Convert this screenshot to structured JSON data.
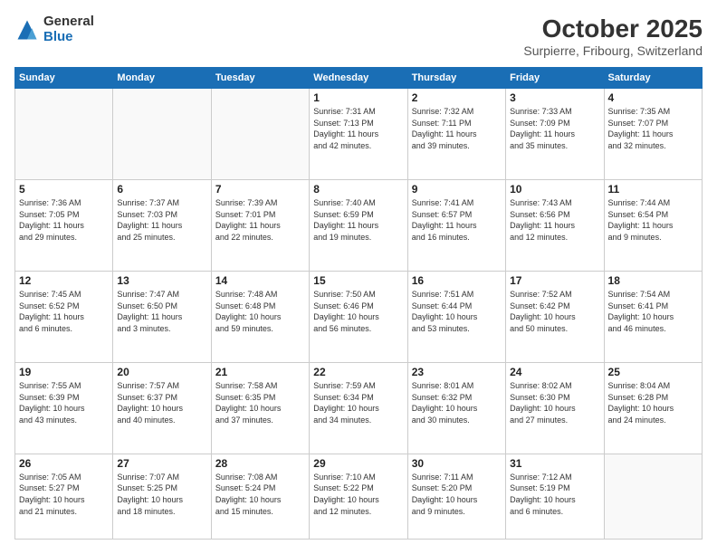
{
  "logo": {
    "general": "General",
    "blue": "Blue"
  },
  "header": {
    "month": "October 2025",
    "location": "Surpierre, Fribourg, Switzerland"
  },
  "weekdays": [
    "Sunday",
    "Monday",
    "Tuesday",
    "Wednesday",
    "Thursday",
    "Friday",
    "Saturday"
  ],
  "weeks": [
    [
      {
        "day": "",
        "info": ""
      },
      {
        "day": "",
        "info": ""
      },
      {
        "day": "",
        "info": ""
      },
      {
        "day": "1",
        "info": "Sunrise: 7:31 AM\nSunset: 7:13 PM\nDaylight: 11 hours\nand 42 minutes."
      },
      {
        "day": "2",
        "info": "Sunrise: 7:32 AM\nSunset: 7:11 PM\nDaylight: 11 hours\nand 39 minutes."
      },
      {
        "day": "3",
        "info": "Sunrise: 7:33 AM\nSunset: 7:09 PM\nDaylight: 11 hours\nand 35 minutes."
      },
      {
        "day": "4",
        "info": "Sunrise: 7:35 AM\nSunset: 7:07 PM\nDaylight: 11 hours\nand 32 minutes."
      }
    ],
    [
      {
        "day": "5",
        "info": "Sunrise: 7:36 AM\nSunset: 7:05 PM\nDaylight: 11 hours\nand 29 minutes."
      },
      {
        "day": "6",
        "info": "Sunrise: 7:37 AM\nSunset: 7:03 PM\nDaylight: 11 hours\nand 25 minutes."
      },
      {
        "day": "7",
        "info": "Sunrise: 7:39 AM\nSunset: 7:01 PM\nDaylight: 11 hours\nand 22 minutes."
      },
      {
        "day": "8",
        "info": "Sunrise: 7:40 AM\nSunset: 6:59 PM\nDaylight: 11 hours\nand 19 minutes."
      },
      {
        "day": "9",
        "info": "Sunrise: 7:41 AM\nSunset: 6:57 PM\nDaylight: 11 hours\nand 16 minutes."
      },
      {
        "day": "10",
        "info": "Sunrise: 7:43 AM\nSunset: 6:56 PM\nDaylight: 11 hours\nand 12 minutes."
      },
      {
        "day": "11",
        "info": "Sunrise: 7:44 AM\nSunset: 6:54 PM\nDaylight: 11 hours\nand 9 minutes."
      }
    ],
    [
      {
        "day": "12",
        "info": "Sunrise: 7:45 AM\nSunset: 6:52 PM\nDaylight: 11 hours\nand 6 minutes."
      },
      {
        "day": "13",
        "info": "Sunrise: 7:47 AM\nSunset: 6:50 PM\nDaylight: 11 hours\nand 3 minutes."
      },
      {
        "day": "14",
        "info": "Sunrise: 7:48 AM\nSunset: 6:48 PM\nDaylight: 10 hours\nand 59 minutes."
      },
      {
        "day": "15",
        "info": "Sunrise: 7:50 AM\nSunset: 6:46 PM\nDaylight: 10 hours\nand 56 minutes."
      },
      {
        "day": "16",
        "info": "Sunrise: 7:51 AM\nSunset: 6:44 PM\nDaylight: 10 hours\nand 53 minutes."
      },
      {
        "day": "17",
        "info": "Sunrise: 7:52 AM\nSunset: 6:42 PM\nDaylight: 10 hours\nand 50 minutes."
      },
      {
        "day": "18",
        "info": "Sunrise: 7:54 AM\nSunset: 6:41 PM\nDaylight: 10 hours\nand 46 minutes."
      }
    ],
    [
      {
        "day": "19",
        "info": "Sunrise: 7:55 AM\nSunset: 6:39 PM\nDaylight: 10 hours\nand 43 minutes."
      },
      {
        "day": "20",
        "info": "Sunrise: 7:57 AM\nSunset: 6:37 PM\nDaylight: 10 hours\nand 40 minutes."
      },
      {
        "day": "21",
        "info": "Sunrise: 7:58 AM\nSunset: 6:35 PM\nDaylight: 10 hours\nand 37 minutes."
      },
      {
        "day": "22",
        "info": "Sunrise: 7:59 AM\nSunset: 6:34 PM\nDaylight: 10 hours\nand 34 minutes."
      },
      {
        "day": "23",
        "info": "Sunrise: 8:01 AM\nSunset: 6:32 PM\nDaylight: 10 hours\nand 30 minutes."
      },
      {
        "day": "24",
        "info": "Sunrise: 8:02 AM\nSunset: 6:30 PM\nDaylight: 10 hours\nand 27 minutes."
      },
      {
        "day": "25",
        "info": "Sunrise: 8:04 AM\nSunset: 6:28 PM\nDaylight: 10 hours\nand 24 minutes."
      }
    ],
    [
      {
        "day": "26",
        "info": "Sunrise: 7:05 AM\nSunset: 5:27 PM\nDaylight: 10 hours\nand 21 minutes."
      },
      {
        "day": "27",
        "info": "Sunrise: 7:07 AM\nSunset: 5:25 PM\nDaylight: 10 hours\nand 18 minutes."
      },
      {
        "day": "28",
        "info": "Sunrise: 7:08 AM\nSunset: 5:24 PM\nDaylight: 10 hours\nand 15 minutes."
      },
      {
        "day": "29",
        "info": "Sunrise: 7:10 AM\nSunset: 5:22 PM\nDaylight: 10 hours\nand 12 minutes."
      },
      {
        "day": "30",
        "info": "Sunrise: 7:11 AM\nSunset: 5:20 PM\nDaylight: 10 hours\nand 9 minutes."
      },
      {
        "day": "31",
        "info": "Sunrise: 7:12 AM\nSunset: 5:19 PM\nDaylight: 10 hours\nand 6 minutes."
      },
      {
        "day": "",
        "info": ""
      }
    ]
  ]
}
